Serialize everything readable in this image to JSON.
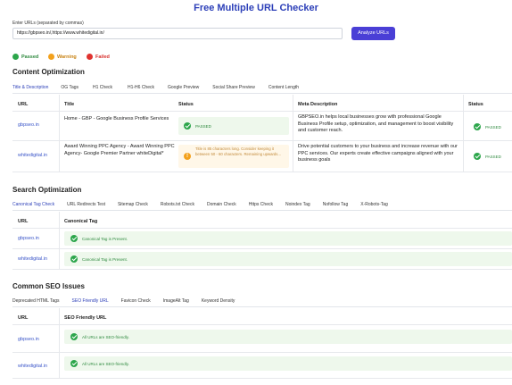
{
  "title": "Free Multiple URL Checker",
  "input": {
    "label": "Enter URLs (separated by commas)",
    "value": "https://gbpseo.in/,https://www.whitedigital.in/"
  },
  "analyze_button": "Analyze URLs",
  "legend": {
    "passed": "Passed",
    "warning": "Warning",
    "failed": "Failed",
    "colors": {
      "passed": "#2ca64b",
      "warning": "#f3a11c",
      "failed": "#e0332f"
    }
  },
  "content_optimization": {
    "title": "Content Optimization",
    "tabs": [
      "Title & Description",
      "OG Tags",
      "H1 Check",
      "H1-H6 Check",
      "Google Preview",
      "Social Share Preview",
      "Content Length"
    ],
    "active_tab": "Title & Description",
    "headers": {
      "url": "URL",
      "title": "Title",
      "status": "Status",
      "meta": "Meta Description",
      "status2": "Status"
    },
    "rows": [
      {
        "url": "gbpseo.in",
        "title": "Home - GBP - Google Business Profile Services",
        "title_status": "PASSED",
        "meta": "GBPSEO.in helps local businesses grow with professional Google Business Profile setup, optimization, and management to boost visibility and customer reach.",
        "meta_status": "PASSED"
      },
      {
        "url": "whitedigital.in",
        "title": "Award Winning PPC Agency - Award Winning PPC Agency- Google Premier Partner whiteDigital*",
        "title_status": "Title is 85 characters long. Consider keeping it between 50 - 60 characters. Remaining upwards...",
        "meta": "Drive potential customers to your business and increase revenue with our PPC services. Our experts create effective campaigns aligned with your business goals",
        "meta_status": "PASSED"
      }
    ]
  },
  "search_optimization": {
    "title": "Search Optimization",
    "tabs": [
      "Canonical Tag Check",
      "URL Redirects Test",
      "Sitemap Check",
      "Robots.txt Check",
      "Domain Check",
      "Https Check",
      "Noindex Tag",
      "Nofollow Tag",
      "X-Robots-Tag"
    ],
    "active_tab": "Canonical Tag Check",
    "headers": {
      "url": "URL",
      "canonical": "Canonical Tag"
    },
    "rows": [
      {
        "url": "gbpseo.in",
        "status": "Canonical Tag is Present."
      },
      {
        "url": "whitedigital.in",
        "status": "Canonical Tag is Present."
      }
    ]
  },
  "common_seo": {
    "title": "Common SEO Issues",
    "tabs": [
      "Deprecated HTML Tags",
      "SEO Friendly URL",
      "Favicon Check",
      "ImageAlt Tag",
      "Keyword Density"
    ],
    "active_tab": "SEO Friendly URL",
    "headers": {
      "url": "URL",
      "seo": "SEO Friendly URL"
    },
    "rows": [
      {
        "url": "gbpseo.in",
        "status": "All URLs are SEO-friendly."
      },
      {
        "url": "whitedigital.in",
        "status": "All URLs are SEO-friendly."
      }
    ]
  }
}
